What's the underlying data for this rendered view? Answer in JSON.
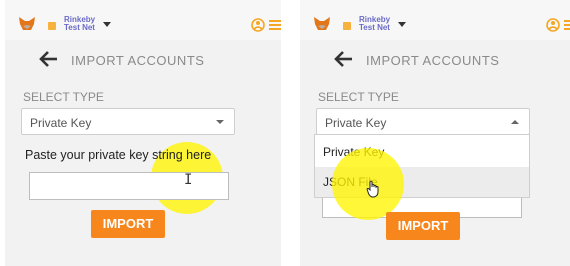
{
  "colors": {
    "accent": "#f7861c",
    "network": "#6b6bc7",
    "highlight": "#fff500"
  },
  "network": {
    "line1": "Rinkeby",
    "line2": "Test Net"
  },
  "page": {
    "title": "IMPORT ACCOUNTS"
  },
  "select": {
    "label": "SELECT TYPE",
    "value": "Private Key",
    "options": [
      "Private Key",
      "JSON File"
    ]
  },
  "form": {
    "paste_label": "Paste your private key string here",
    "key_value": ""
  },
  "buttons": {
    "import_label": "IMPORT"
  },
  "icons": {
    "logo": "fox-icon",
    "back": "back-arrow-icon",
    "account": "account-switch-icon",
    "menu": "hamburger-menu-icon",
    "cursor_text": "text-cursor-icon",
    "cursor_hand": "hand-cursor-icon"
  }
}
